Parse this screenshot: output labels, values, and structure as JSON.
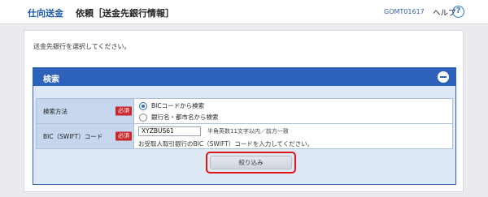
{
  "header": {
    "app_name": "仕向送金",
    "page_title": "依頼［送金先銀行情報］",
    "screen_id": "GOMT01617",
    "help_label": "ヘルプ",
    "help_icon_glyph": "?"
  },
  "instruction": "送金先銀行を選択してください。",
  "search": {
    "title": "検索",
    "collapse_icon": "minus-circle-icon",
    "method": {
      "label": "検索方法",
      "required": "必須",
      "options": [
        {
          "label": "BICコードから検索",
          "selected": true
        },
        {
          "label": "銀行名・都市名から検索",
          "selected": false
        }
      ]
    },
    "bic": {
      "label": "BIC（SWIFT）コード",
      "required": "必須",
      "value": "XYZBUS61",
      "hint": "半角英数11文字以内／前方一致",
      "note": "お受取人取引銀行のBIC（SWIFT）コードを入力してください。"
    },
    "submit_label": "絞り込み"
  },
  "colors": {
    "accent": "#2c62b9",
    "required_badge": "#c8282d",
    "highlight": "#e0151b"
  }
}
